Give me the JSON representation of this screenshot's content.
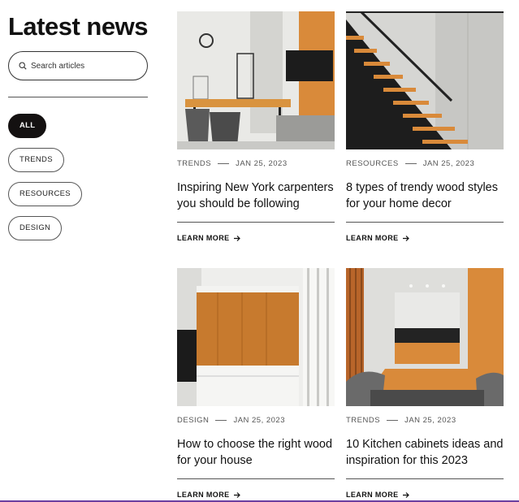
{
  "header": {
    "title": "Latest news"
  },
  "search": {
    "placeholder": "Search articles"
  },
  "filters": [
    {
      "label": "ALL",
      "active": true
    },
    {
      "label": "TRENDS",
      "active": false
    },
    {
      "label": "RESOURCES",
      "active": false
    },
    {
      "label": "DESIGN",
      "active": false
    }
  ],
  "articles": [
    {
      "category": "TRENDS",
      "date": "JAN 25, 2023",
      "title": "Inspiring New York carpenters you should be following",
      "cta": "LEARN MORE"
    },
    {
      "category": "RESOURCES",
      "date": "JAN 25, 2023",
      "title": "8 types of trendy wood styles for your home decor",
      "cta": "LEARN MORE"
    },
    {
      "category": "DESIGN",
      "date": "JAN 25, 2023",
      "title": "How to choose the right wood for your house",
      "cta": "LEARN MORE"
    },
    {
      "category": "TRENDS",
      "date": "JAN 25, 2023",
      "title": "10 Kitchen cabinets ideas and inspiration for this 2023",
      "cta": "LEARN MORE"
    }
  ],
  "colors": {
    "accent": "#141111",
    "wood": "#d98a3a",
    "bottom_bar": "#6b3fa0"
  }
}
